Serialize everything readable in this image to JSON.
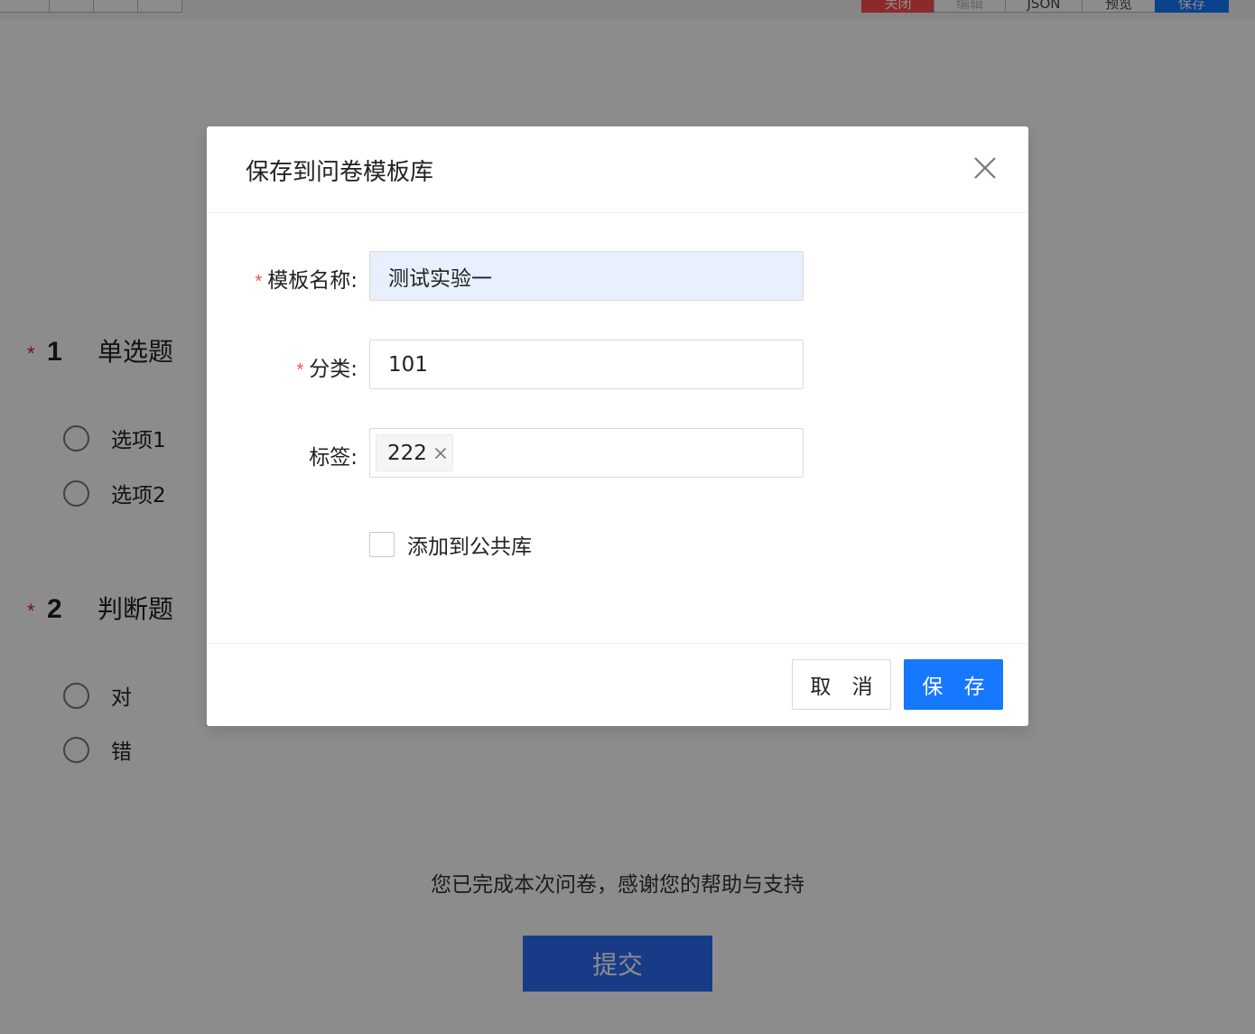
{
  "toolbar": {
    "left_buttons": [
      "",
      "",
      "",
      ""
    ],
    "right_buttons": [
      "关闭",
      "编辑",
      "JSON",
      "预览",
      "保存"
    ]
  },
  "survey": {
    "questions": [
      {
        "required_mark": "*",
        "number": "1",
        "title": "单选题",
        "options": [
          "选项1",
          "选项2"
        ]
      },
      {
        "required_mark": "*",
        "number": "2",
        "title": "判断题",
        "options": [
          "对",
          "错"
        ]
      }
    ],
    "completion_text": "您已完成本次问卷，感谢您的帮助与支持",
    "submit_label": "提交"
  },
  "modal": {
    "title": "保存到问卷模板库",
    "fields": {
      "template_name": {
        "required_mark": "*",
        "label": "模板名称:",
        "value": "测试实验一"
      },
      "category": {
        "required_mark": "*",
        "label": "分类:",
        "value": "101"
      },
      "tags": {
        "label": "标签:",
        "items": [
          "222"
        ]
      }
    },
    "add_public_label": "添加到公共库",
    "add_public_checked": false,
    "cancel_label": "取 消",
    "save_label": "保 存"
  },
  "colors": {
    "primary": "#1677ff",
    "danger": "#ff4d4f",
    "required": "#ff4d4f",
    "mask": "rgba(0,0,0,0.45)"
  }
}
